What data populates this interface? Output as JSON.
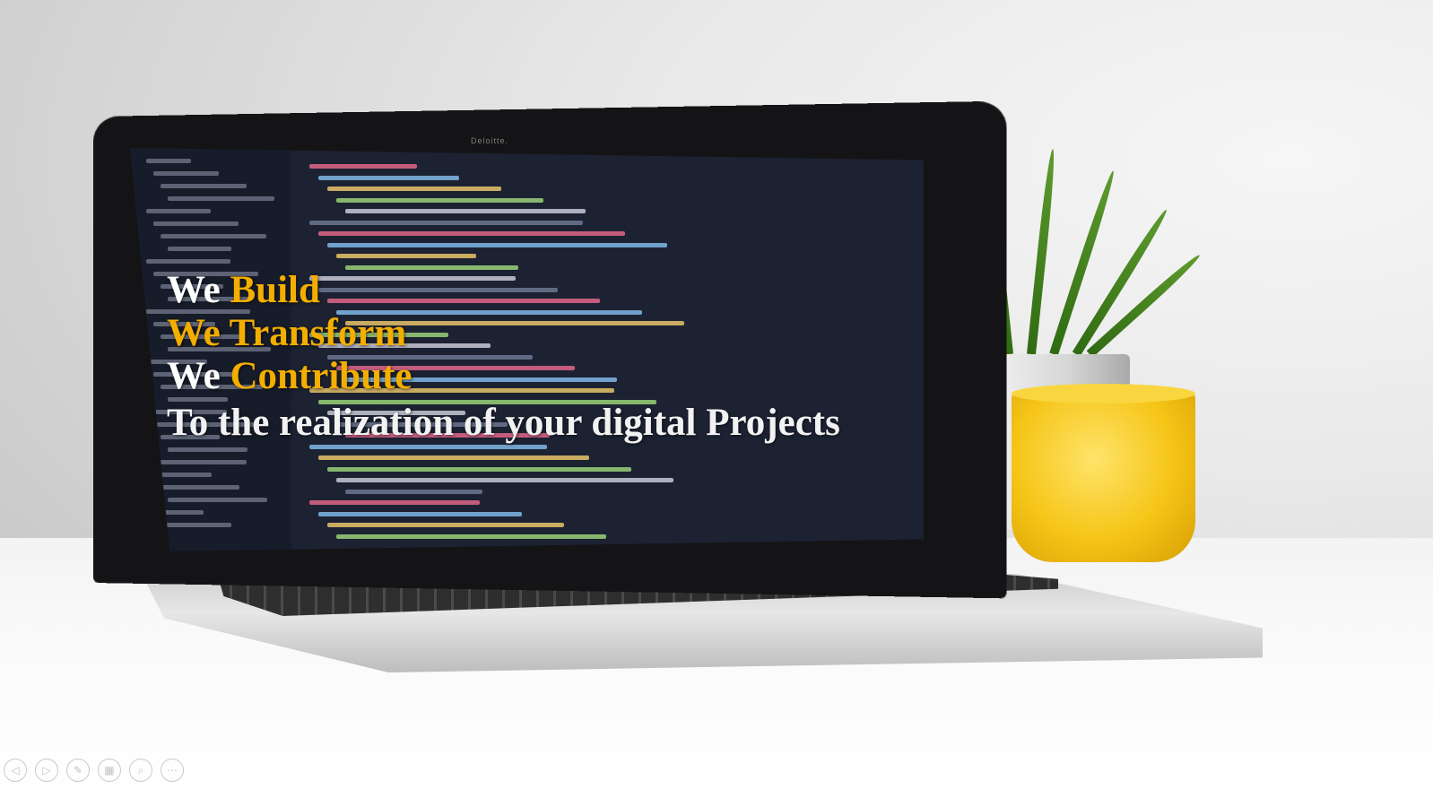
{
  "slide": {
    "headline": [
      {
        "white": "We",
        "orange": "Build"
      },
      {
        "white": "",
        "orange": "We Transform"
      },
      {
        "white": "We",
        "orange": "Contribute"
      }
    ],
    "tagline": "To the realization of your digital Projects",
    "laptop_brand_label": "Deloitte."
  },
  "colors": {
    "accent": "#f4ae00",
    "text": "#ffffff"
  },
  "controls": [
    {
      "name": "previous-slide-button",
      "icon": "chevron-left-icon",
      "glyph": "◁"
    },
    {
      "name": "next-slide-button",
      "icon": "chevron-right-icon",
      "glyph": "▷"
    },
    {
      "name": "pen-tool-button",
      "icon": "pen-icon",
      "glyph": "✎"
    },
    {
      "name": "slide-sorter-button",
      "icon": "grid-icon",
      "glyph": "▦"
    },
    {
      "name": "zoom-button",
      "icon": "magnifier-icon",
      "glyph": "⌕"
    },
    {
      "name": "more-options-button",
      "icon": "ellipsis-icon",
      "glyph": "⋯"
    }
  ]
}
